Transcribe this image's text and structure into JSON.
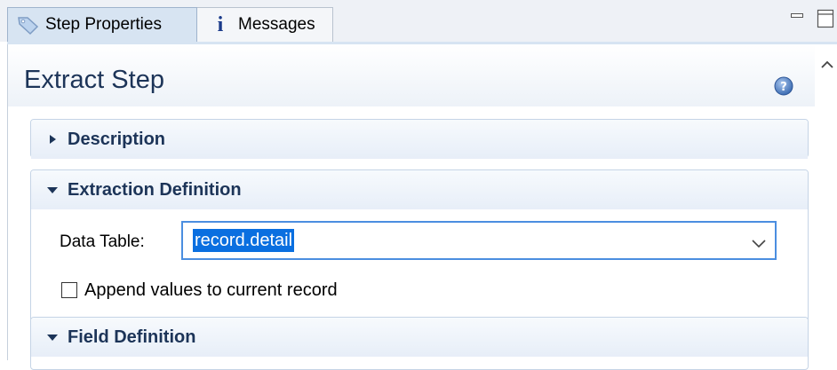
{
  "tabs": [
    {
      "label": "Step Properties",
      "icon": "tag-icon",
      "active": true
    },
    {
      "label": "Messages",
      "icon": "info-icon",
      "active": false
    }
  ],
  "window_controls": {
    "minimize_icon": "minimize-icon",
    "maximize_icon": "maximize-icon"
  },
  "form": {
    "title": "Extract Step",
    "help_icon": "help-icon"
  },
  "sections": {
    "description": {
      "label": "Description",
      "expanded": false
    },
    "extraction": {
      "label": "Extraction Definition",
      "expanded": true,
      "data_table_label": "Data Table:",
      "data_table_value": "record.detail",
      "append_label": "Append values to current record",
      "append_checked": false
    },
    "field": {
      "label": "Field Definition",
      "expanded": true
    }
  },
  "colors": {
    "title": "#1c3458",
    "accent": "#0a6fe0",
    "tab_active_bg": "#d7e4f2"
  }
}
